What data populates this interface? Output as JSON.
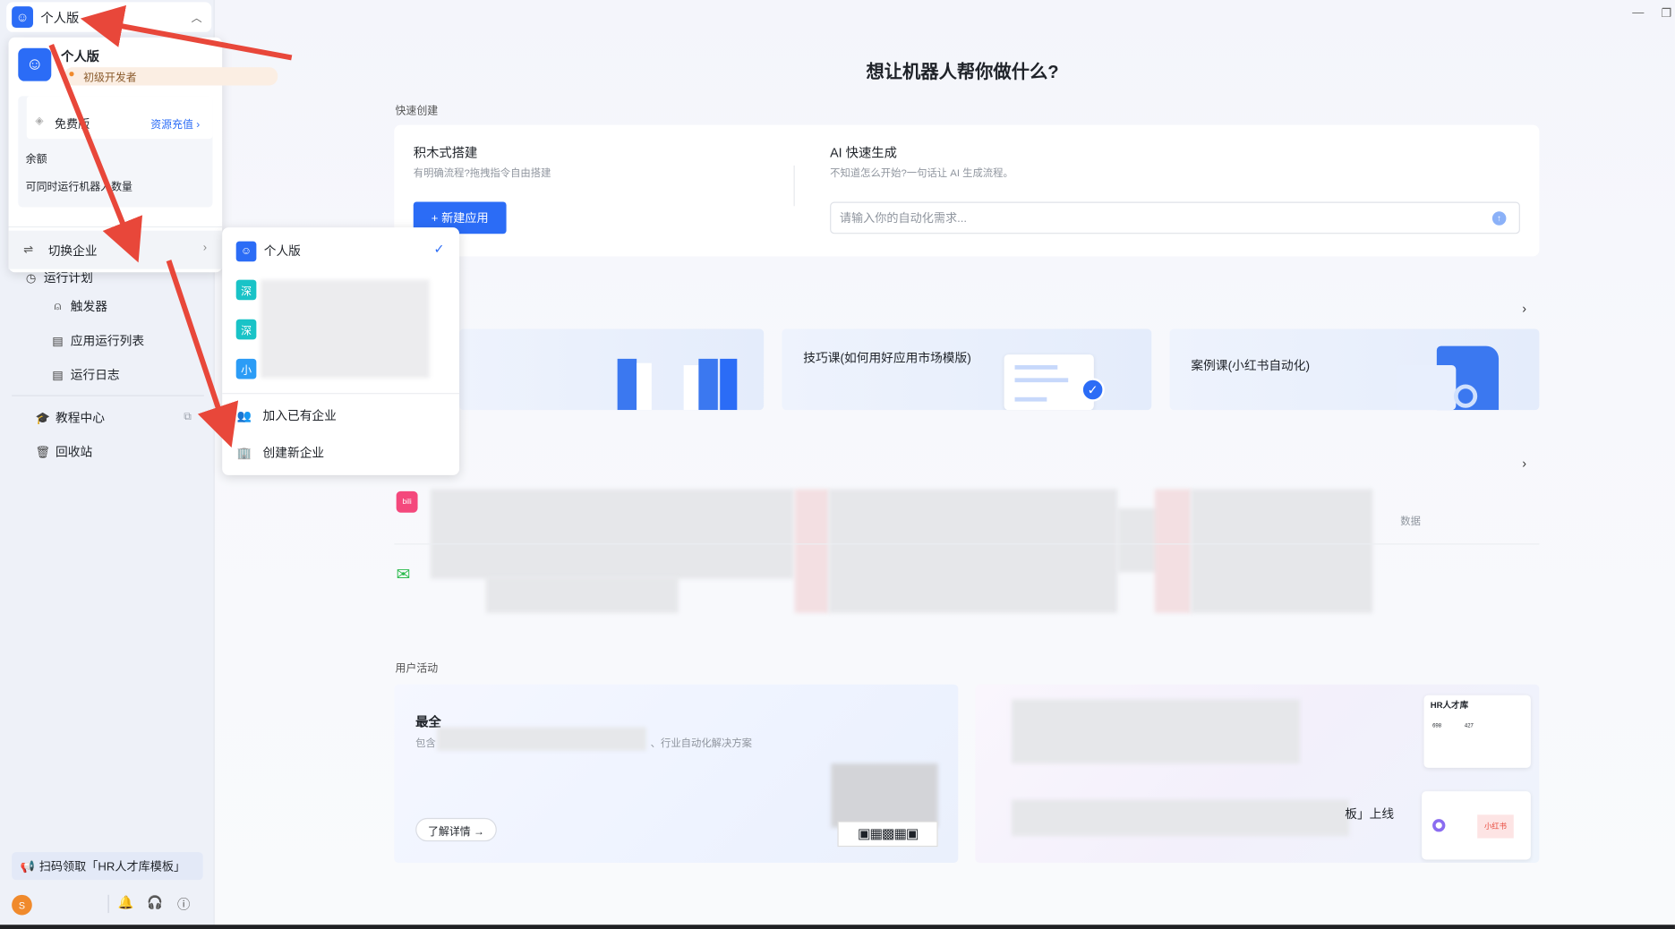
{
  "workspace": {
    "current": "个人版"
  },
  "sidebar": {
    "nav": [
      {
        "label": "运行计划",
        "icon": "clock-icon"
      },
      {
        "label": "触发器",
        "icon": "trigger-icon"
      },
      {
        "label": "应用运行列表",
        "icon": "list-icon"
      },
      {
        "label": "运行日志",
        "icon": "log-icon"
      },
      {
        "label": "教程中心",
        "icon": "graduation-cap-icon"
      },
      {
        "label": "回收站",
        "icon": "trash-icon"
      }
    ],
    "promo": "扫码领取「HR人才库模板」",
    "avatar_letter": "S"
  },
  "account_panel": {
    "name": "个人版",
    "level": "初级开发者",
    "plan": "免费版",
    "recharge": "资源充值 ›",
    "balance_label": "余额",
    "concurrent_label": "可同时运行机器人数量",
    "switch_label": "切换企业"
  },
  "enterprise_panel": {
    "items": [
      {
        "icon_text": "",
        "label": "个人版",
        "color": "#2b6cf6",
        "selected": true
      },
      {
        "icon_text": "深",
        "label": "",
        "color": "#19c3c7"
      },
      {
        "icon_text": "深",
        "label": "",
        "color": "#19c3c7"
      },
      {
        "icon_text": "小",
        "label": "",
        "color": "#2b9cf6"
      }
    ],
    "join": "加入已有企业",
    "create": "创建新企业"
  },
  "main": {
    "headline": "想让机器人帮你做什么?",
    "quick_create_label": "快速创建",
    "builder": {
      "title": "积木式搭建",
      "subtitle": "有明确流程?拖拽指令自由搭建",
      "button": "+ 新建应用"
    },
    "ai": {
      "title": "AI 快速生成",
      "subtitle": "不知道怎么开始?一句话让 AI 生成流程。",
      "placeholder": "请输入你的自动化需求..."
    },
    "courses": [
      {
        "title": ""
      },
      {
        "title": "技巧课(如何用好应用市场模版)"
      },
      {
        "title": "案例课(小红书自动化)"
      }
    ],
    "market_partial": "数据",
    "activity_label": "用户活动",
    "activity": {
      "title_fragment": "最全",
      "desc_prefix": "包含",
      "desc_suffix": "、行业自动化解决方案",
      "button": "了解详情 →",
      "hr_card_title": "HR人才库",
      "launch_fragment": "板」上线",
      "xhs_tag": "小红书",
      "hr_numbers": [
        "698",
        "427"
      ]
    }
  },
  "colors": {
    "accent": "#2b6cf6",
    "arrow": "#e8473a",
    "sidebar_bg": "#eef1f8"
  }
}
